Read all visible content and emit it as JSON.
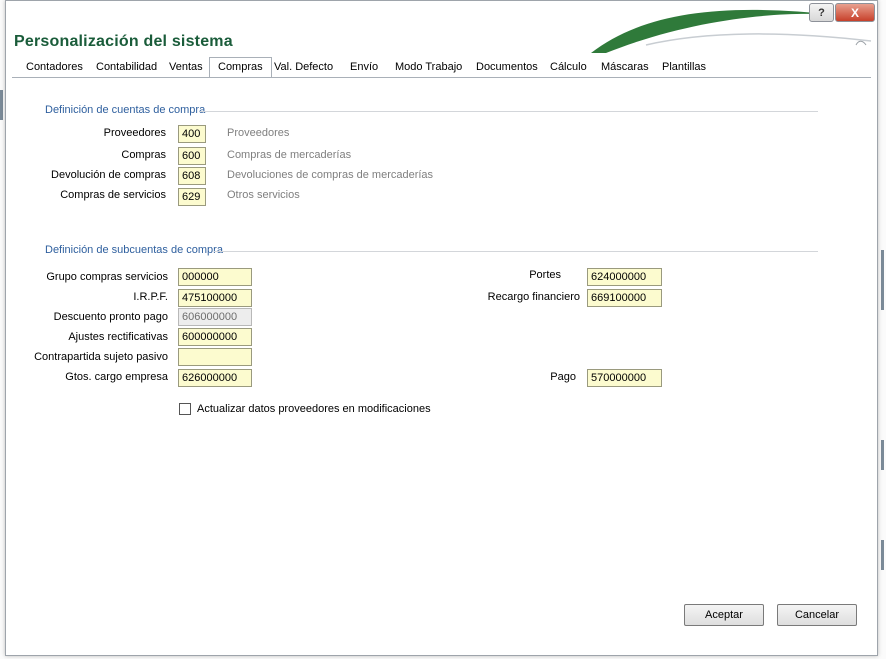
{
  "window": {
    "title": "Personalización del sistema",
    "help_button": "?",
    "close_button": "X"
  },
  "tabs": [
    {
      "label": "Contadores",
      "active": false
    },
    {
      "label": "Contabilidad",
      "active": false
    },
    {
      "label": "Ventas",
      "active": false
    },
    {
      "label": "Compras",
      "active": true
    },
    {
      "label": "Val. Defecto",
      "active": false
    },
    {
      "label": "Envío",
      "active": false
    },
    {
      "label": "Modo Trabajo",
      "active": false
    },
    {
      "label": "Documentos",
      "active": false
    },
    {
      "label": "Cálculo",
      "active": false
    },
    {
      "label": "Máscaras",
      "active": false
    },
    {
      "label": "Plantillas",
      "active": false
    }
  ],
  "cuentas": {
    "title": "Definición de cuentas de compra",
    "rows": [
      {
        "label": "Proveedores",
        "value": "400",
        "description": "Proveedores"
      },
      {
        "label": "Compras",
        "value": "600",
        "description": "Compras de mercaderías"
      },
      {
        "label": "Devolución de compras",
        "value": "608",
        "description": "Devoluciones de compras de mercaderías"
      },
      {
        "label": "Compras de servicios",
        "value": "629",
        "description": "Otros servicios"
      }
    ]
  },
  "subcuentas": {
    "title": "Definición de subcuentas de compra",
    "left": [
      {
        "label": "Grupo compras servicios",
        "value": "000000",
        "disabled": false
      },
      {
        "label": "I.R.P.F.",
        "value": "475100000",
        "disabled": false
      },
      {
        "label": "Descuento pronto pago",
        "value": "606000000",
        "disabled": true
      },
      {
        "label": "Ajustes rectificativas",
        "value": "600000000",
        "disabled": false
      },
      {
        "label": "Contrapartida sujeto pasivo",
        "value": "",
        "disabled": false
      },
      {
        "label": "Gtos. cargo empresa",
        "value": "626000000",
        "disabled": false
      }
    ],
    "right": [
      {
        "label": "Portes",
        "value": "624000000"
      },
      {
        "label": "Recargo financiero",
        "value": "669100000"
      },
      {
        "label": "Pago",
        "value": "570000000"
      }
    ]
  },
  "checkbox": {
    "label": "Actualizar datos proveedores en modificaciones",
    "checked": false
  },
  "buttons": {
    "accept": "Aceptar",
    "cancel": "Cancelar"
  },
  "colors": {
    "title": "#1a5c3a",
    "section": "#2e5f9e",
    "field_bg": "#fcfbcf"
  }
}
